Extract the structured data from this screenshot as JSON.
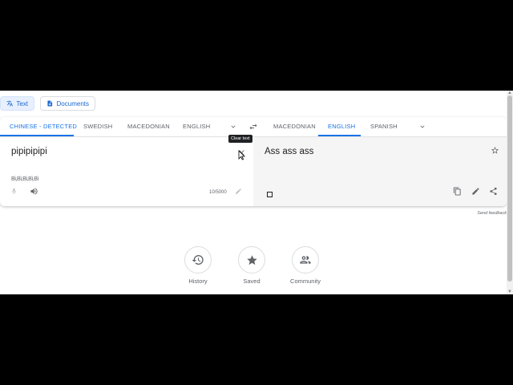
{
  "modes": {
    "text_label": "Text",
    "documents_label": "Documents"
  },
  "source_languages": {
    "detected": "CHINESE - DETECTED",
    "items": [
      "SWEDISH",
      "MACEDONIAN",
      "ENGLISH"
    ]
  },
  "target_languages": {
    "items": [
      "MACEDONIAN",
      "ENGLISH",
      "SPANISH"
    ],
    "selected": "ENGLISH"
  },
  "source": {
    "text": "pipipipipi",
    "romanization": "Bì,Bì,Bì,Bì,Bì",
    "char_count": "10/5000"
  },
  "target": {
    "text": "Ass ass ass"
  },
  "tooltip": "Clear text",
  "feedback": "Send feedback",
  "bottom_nav": {
    "history": "History",
    "saved": "Saved",
    "community": "Community"
  },
  "colors": {
    "accent": "#1a73e8",
    "text": "#202124",
    "muted": "#5f6368"
  }
}
